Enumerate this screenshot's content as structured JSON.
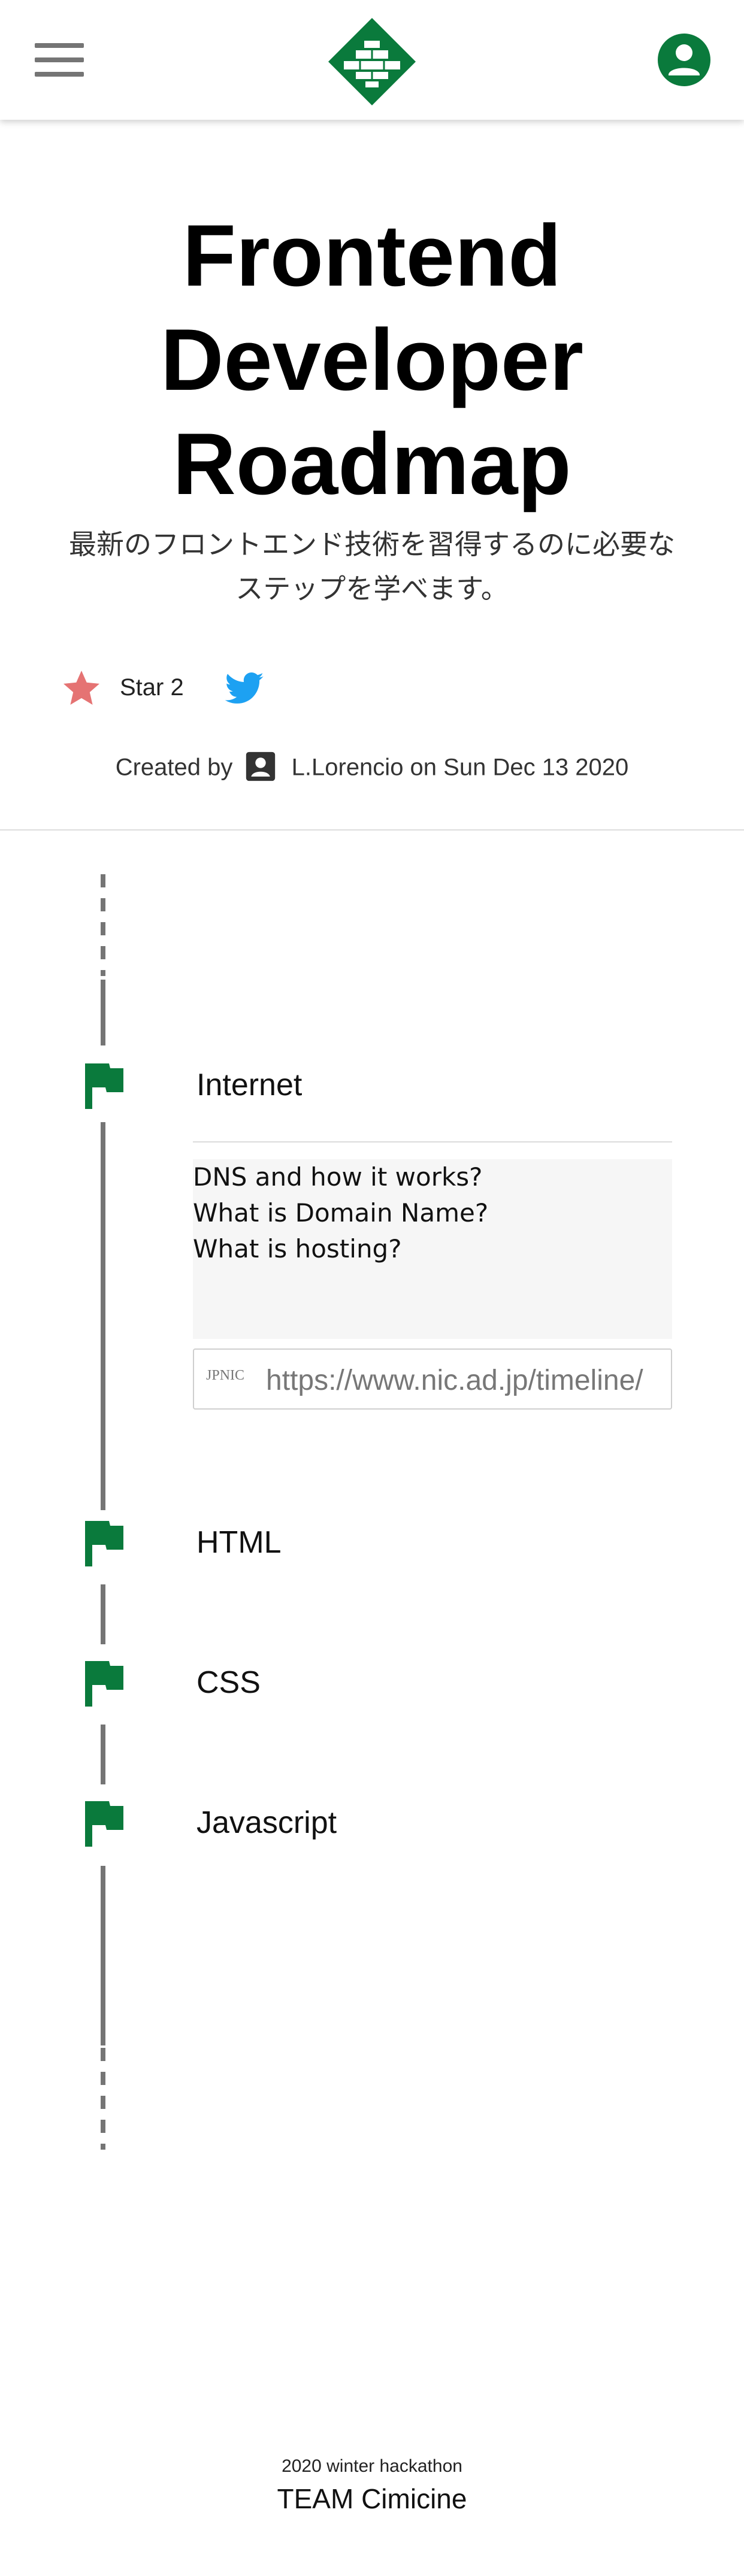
{
  "header": {
    "menu_icon": "hamburger-menu-icon",
    "logo_icon": "green-diamond-brick-logo",
    "account_icon": "account-circle-icon",
    "brand_color": "#0a7a3c"
  },
  "hero": {
    "title_line1": "Frontend",
    "title_line2": "Developer",
    "title_line3": "Roadmap",
    "subtitle_line1": "最新のフロントエンド技術を習得するのに必要な",
    "subtitle_line2": "ステップを学べます。"
  },
  "actions": {
    "star_icon": "star-icon",
    "star_label": "Star 2",
    "star_color": "#e57373",
    "twitter_icon": "twitter-icon",
    "twitter_color": "#1da1f2"
  },
  "meta": {
    "created_by": "Created by",
    "author_icon": "account-box-icon",
    "author_and_date": "L.Lorencio on Sun Dec 13 2020"
  },
  "roadmap": {
    "flag_icon": "flag-icon",
    "steps": [
      {
        "label": "Internet",
        "notes": [
          "DNS and how it works?",
          "What is Domain Name?",
          "What is hosting?"
        ],
        "link": "https://www.nic.ad.jp/timeline/",
        "link_favicon": "JPNIC"
      },
      {
        "label": "HTML"
      },
      {
        "label": "CSS"
      },
      {
        "label": "Javascript"
      }
    ]
  },
  "footer": {
    "event": "2020 winter hackathon",
    "team": "TEAM Cimicine"
  }
}
